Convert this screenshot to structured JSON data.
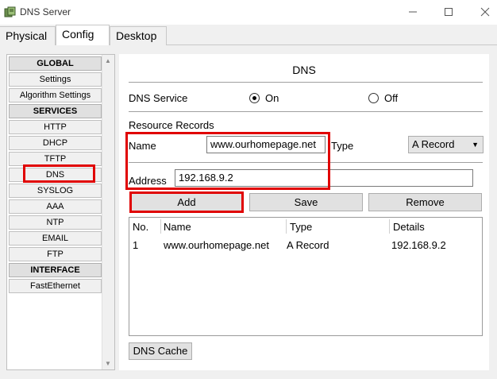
{
  "window": {
    "title": "DNS Server",
    "icon": "network-server-icon"
  },
  "tabs": [
    {
      "label": "Physical"
    },
    {
      "label": "Config"
    },
    {
      "label": "Desktop"
    }
  ],
  "sidebar": {
    "items": [
      {
        "label": "GLOBAL",
        "header": true
      },
      {
        "label": "Settings"
      },
      {
        "label": "Algorithm Settings"
      },
      {
        "label": "SERVICES",
        "header": true
      },
      {
        "label": "HTTP"
      },
      {
        "label": "DHCP"
      },
      {
        "label": "TFTP"
      },
      {
        "label": "DNS",
        "selected": true
      },
      {
        "label": "SYSLOG"
      },
      {
        "label": "AAA"
      },
      {
        "label": "NTP"
      },
      {
        "label": "EMAIL"
      },
      {
        "label": "FTP"
      },
      {
        "label": "INTERFACE",
        "header": true
      },
      {
        "label": "FastEthernet"
      }
    ]
  },
  "dns": {
    "heading": "DNS",
    "service_label": "DNS Service",
    "on_label": "On",
    "off_label": "Off",
    "resource_records_label": "Resource Records",
    "name_label": "Name",
    "name_value": "www.ourhomepage.net",
    "type_label": "Type",
    "type_value": "A Record",
    "address_label": "Address",
    "address_value": "192.168.9.2",
    "add_label": "Add",
    "save_label": "Save",
    "remove_label": "Remove",
    "table": {
      "columns": [
        "No.",
        "Name",
        "Type",
        "Details"
      ],
      "rows": [
        {
          "no": "1",
          "name": "www.ourhomepage.net",
          "type": "A Record",
          "details": "192.168.9.2"
        }
      ]
    },
    "cache_label": "DNS Cache"
  },
  "colors": {
    "highlight": "#e00000"
  }
}
